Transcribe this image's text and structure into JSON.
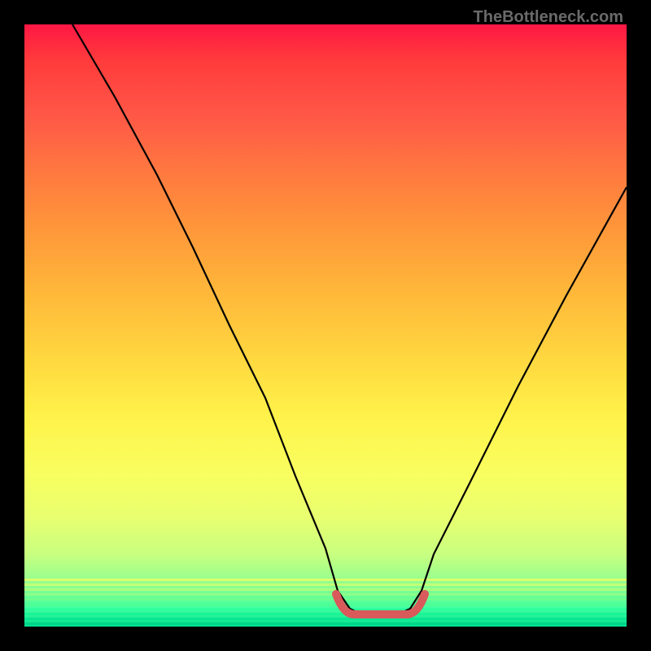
{
  "attribution": "TheBottleneck.com",
  "chart_data": {
    "type": "line",
    "title": "",
    "xlabel": "",
    "ylabel": "",
    "xlim": [
      0,
      100
    ],
    "ylim": [
      0,
      100
    ],
    "series": [
      {
        "name": "bottleneck-curve",
        "x": [
          8,
          15,
          22,
          28,
          34,
          40,
          45,
          50,
          52,
          54,
          56,
          58,
          60,
          62,
          64,
          66,
          68,
          74,
          82,
          90,
          100
        ],
        "y": [
          100,
          88,
          75,
          63,
          50,
          38,
          25,
          13,
          6,
          3,
          2,
          2,
          2,
          2,
          3,
          6,
          12,
          24,
          40,
          55,
          73
        ]
      }
    ],
    "annotations": {
      "optimal_band": {
        "x_start": 52,
        "x_end": 66,
        "color": "#d85a5a"
      }
    },
    "gradient_stops": [
      {
        "pos": 0,
        "color": "#ff1744"
      },
      {
        "pos": 6,
        "color": "#ff3b3b"
      },
      {
        "pos": 15,
        "color": "#ff5747"
      },
      {
        "pos": 25,
        "color": "#ff7a3f"
      },
      {
        "pos": 35,
        "color": "#ff9a3a"
      },
      {
        "pos": 45,
        "color": "#ffb93a"
      },
      {
        "pos": 55,
        "color": "#ffd63f"
      },
      {
        "pos": 65,
        "color": "#fff24a"
      },
      {
        "pos": 75,
        "color": "#f8ff60"
      },
      {
        "pos": 82,
        "color": "#e8ff70"
      },
      {
        "pos": 88,
        "color": "#c8ff80"
      },
      {
        "pos": 93,
        "color": "#8fff90"
      },
      {
        "pos": 97,
        "color": "#40ffa0"
      },
      {
        "pos": 100,
        "color": "#00e090"
      }
    ],
    "band_colors": {
      "curve_stroke": "#000000",
      "optimal_stroke": "#d85a5a"
    }
  }
}
